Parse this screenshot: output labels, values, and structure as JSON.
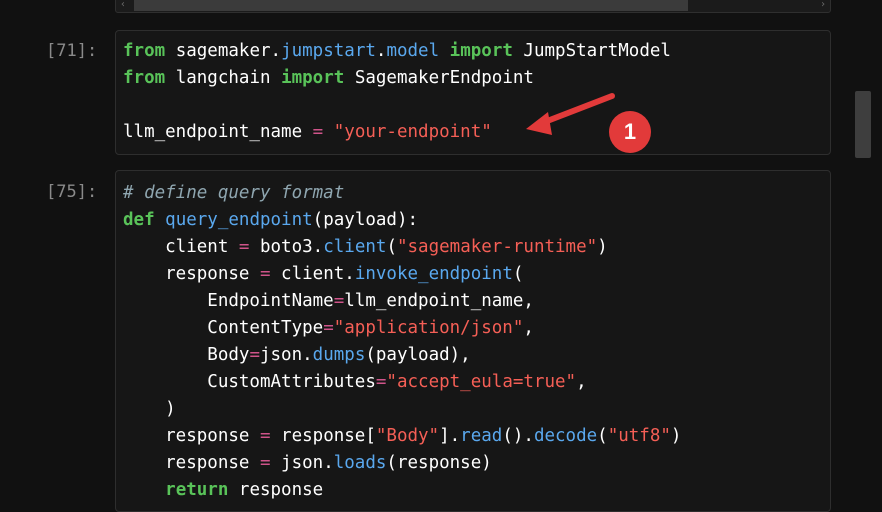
{
  "cells": [
    {
      "prompt": "[71]:",
      "lines": [
        [
          {
            "t": "from",
            "c": "kw"
          },
          {
            "t": " sagemaker."
          },
          {
            "t": "jumpstart",
            "c": "fn"
          },
          {
            "t": "."
          },
          {
            "t": "model",
            "c": "fn"
          },
          {
            "t": " "
          },
          {
            "t": "import",
            "c": "kw"
          },
          {
            "t": " JumpStartModel"
          }
        ],
        [
          {
            "t": "from",
            "c": "kw"
          },
          {
            "t": " langchain "
          },
          {
            "t": "import",
            "c": "kw"
          },
          {
            "t": " SagemakerEndpoint"
          }
        ],
        [],
        [
          {
            "t": "llm_endpoint_name "
          },
          {
            "t": "=",
            "c": "op"
          },
          {
            "t": " "
          },
          {
            "t": "\"your-endpoint\"",
            "c": "str"
          }
        ]
      ]
    },
    {
      "prompt": "[75]:",
      "lines": [
        [
          {
            "t": "# define query format",
            "c": "cm"
          }
        ],
        [
          {
            "t": "def",
            "c": "kw"
          },
          {
            "t": " "
          },
          {
            "t": "query_endpoint",
            "c": "fn"
          },
          {
            "t": "(payload):"
          }
        ],
        [
          {
            "t": "    client "
          },
          {
            "t": "=",
            "c": "op"
          },
          {
            "t": " boto3."
          },
          {
            "t": "client",
            "c": "fn"
          },
          {
            "t": "("
          },
          {
            "t": "\"sagemaker-runtime\"",
            "c": "str"
          },
          {
            "t": ")"
          }
        ],
        [
          {
            "t": "    response "
          },
          {
            "t": "=",
            "c": "op"
          },
          {
            "t": " client."
          },
          {
            "t": "invoke_endpoint",
            "c": "fn"
          },
          {
            "t": "("
          }
        ],
        [
          {
            "t": "        EndpointName"
          },
          {
            "t": "=",
            "c": "op"
          },
          {
            "t": "llm_endpoint_name,"
          }
        ],
        [
          {
            "t": "        ContentType"
          },
          {
            "t": "=",
            "c": "op"
          },
          {
            "t": "\"application/json\"",
            "c": "str"
          },
          {
            "t": ","
          }
        ],
        [
          {
            "t": "        Body"
          },
          {
            "t": "=",
            "c": "op"
          },
          {
            "t": "json."
          },
          {
            "t": "dumps",
            "c": "fn"
          },
          {
            "t": "(payload),"
          }
        ],
        [
          {
            "t": "        CustomAttributes"
          },
          {
            "t": "=",
            "c": "op"
          },
          {
            "t": "\"accept_eula=true\"",
            "c": "str"
          },
          {
            "t": ","
          }
        ],
        [
          {
            "t": "    )"
          }
        ],
        [
          {
            "t": "    response "
          },
          {
            "t": "=",
            "c": "op"
          },
          {
            "t": " response["
          },
          {
            "t": "\"Body\"",
            "c": "str"
          },
          {
            "t": "]."
          },
          {
            "t": "read",
            "c": "fn"
          },
          {
            "t": "()."
          },
          {
            "t": "decode",
            "c": "fn"
          },
          {
            "t": "("
          },
          {
            "t": "\"utf8\"",
            "c": "str"
          },
          {
            "t": ")"
          }
        ],
        [
          {
            "t": "    response "
          },
          {
            "t": "=",
            "c": "op"
          },
          {
            "t": " json."
          },
          {
            "t": "loads",
            "c": "fn"
          },
          {
            "t": "(response)"
          }
        ],
        [
          {
            "t": "    "
          },
          {
            "t": "return",
            "c": "kw"
          },
          {
            "t": " response"
          }
        ]
      ]
    }
  ],
  "annotation": {
    "label": "1",
    "color": "#e23a3a"
  },
  "icons": {
    "scroll_left": "chevron-left-icon",
    "scroll_right": "chevron-right-icon"
  },
  "colors": {
    "background": "#111111",
    "keyword": "#59c359",
    "string": "#f55f56",
    "function": "#5aa8ee",
    "operator": "#d0548a",
    "comment": "#8fa6b0"
  }
}
